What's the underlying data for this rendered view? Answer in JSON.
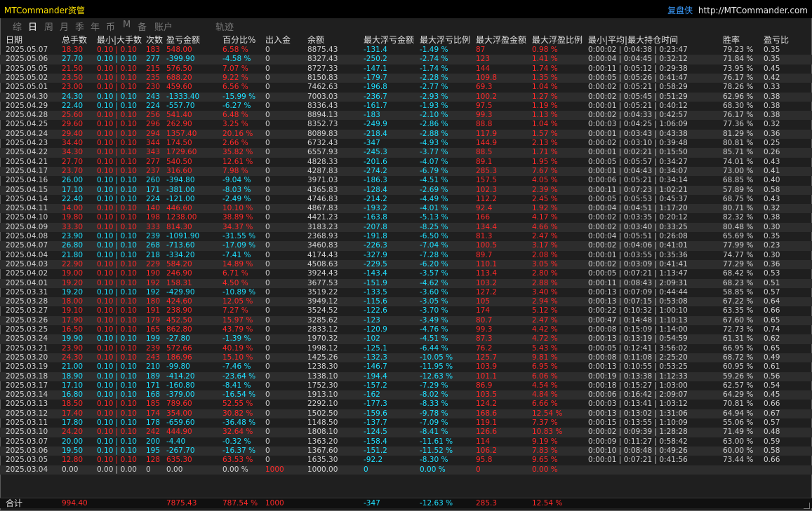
{
  "title": "MTCommander资管",
  "brand": {
    "name": "复盘侠",
    "url": "http://MTCommander.com"
  },
  "tabs": [
    "综",
    "日",
    "周",
    "月",
    "季",
    "年",
    "币",
    "M",
    "备",
    "账户",
    "轨迹"
  ],
  "active_tab": 1,
  "headers": [
    "日期",
    "总手数",
    "最小|大手数",
    "次数",
    "盈亏金额",
    "百分比%",
    "出入金",
    "余额",
    "最大浮亏金额",
    "最大浮亏比例",
    "最大浮盈金额",
    "最大浮盈比例",
    "最小|平均|最大持仓时间",
    "胜率",
    "盈亏比"
  ],
  "rows": [
    [
      "2025.05.07",
      "18.30",
      "0.10 | 0.10",
      "183",
      "548.00",
      "6.58 %",
      "0",
      "8875.43",
      "-131.4",
      "-1.49 %",
      "87",
      "0.98 %",
      "0:00:02 | 0:04:38 | 0:23:47",
      "79.23 %",
      "0.35"
    ],
    [
      "2025.05.06",
      "27.70",
      "0.10 | 0.10",
      "277",
      "-399.90",
      "-4.58 %",
      "0",
      "8327.43",
      "-250.2",
      "-2.74 %",
      "123",
      "1.41 %",
      "0:00:04 | 0:04:45 | 0:32:12",
      "71.84 %",
      "0.35"
    ],
    [
      "2025.05.05",
      "21.50",
      "0.10 | 0.10",
      "215",
      "576.50",
      "7.07 %",
      "0",
      "8727.33",
      "-147.1",
      "-1.74 %",
      "144",
      "1.74 %",
      "0:00:11 | 0:05:12 | 0:29:38",
      "73.95 %",
      "0.45"
    ],
    [
      "2025.05.02",
      "23.50",
      "0.10 | 0.10",
      "235",
      "688.20",
      "9.22 %",
      "0",
      "8150.83",
      "-179.7",
      "-2.28 %",
      "109.8",
      "1.35 %",
      "0:00:05 | 0:05:26 | 0:41:47",
      "76.17 %",
      "0.42"
    ],
    [
      "2025.05.01",
      "23.00",
      "0.10 | 0.10",
      "230",
      "459.60",
      "6.56 %",
      "0",
      "7462.63",
      "-196.8",
      "-2.77 %",
      "69.3",
      "1.04 %",
      "0:00:02 | 0:05:21 | 0:58:29",
      "78.26 %",
      "0.33"
    ],
    [
      "2025.04.30",
      "24.30",
      "0.10 | 0.10",
      "243",
      "-1333.40",
      "-15.99 %",
      "0",
      "7003.03",
      "-236.7",
      "-2.93 %",
      "100.2",
      "1.27 %",
      "0:00:02 | 0:05:45 | 0:51:29",
      "62.96 %",
      "0.38"
    ],
    [
      "2025.04.29",
      "22.40",
      "0.10 | 0.10",
      "224",
      "-557.70",
      "-6.27 %",
      "0",
      "8336.43",
      "-161.7",
      "-1.93 %",
      "97.5",
      "1.19 %",
      "0:00:01 | 0:05:21 | 0:40:12",
      "68.30 %",
      "0.38"
    ],
    [
      "2025.04.28",
      "25.60",
      "0.10 | 0.10",
      "256",
      "541.40",
      "6.48 %",
      "0",
      "8894.13",
      "-183",
      "-2.10 %",
      "99.3",
      "1.13 %",
      "0:00:02 | 0:04:33 | 0:42:57",
      "76.17 %",
      "0.38"
    ],
    [
      "2025.04.25",
      "29.60",
      "0.10 | 0.10",
      "296",
      "262.90",
      "3.25 %",
      "0",
      "8352.73",
      "-249.9",
      "-2.86 %",
      "88.8",
      "1.04 %",
      "0:00:03 | 0:04:25 | 1:06:09",
      "77.36 %",
      "0.32"
    ],
    [
      "2025.04.24",
      "29.40",
      "0.10 | 0.10",
      "294",
      "1357.40",
      "20.16 %",
      "0",
      "8089.83",
      "-218.4",
      "-2.88 %",
      "117.9",
      "1.57 %",
      "0:00:01 | 0:03:43 | 0:43:38",
      "81.29 %",
      "0.36"
    ],
    [
      "2025.04.23",
      "34.40",
      "0.10 | 0.10",
      "344",
      "174.50",
      "2.66 %",
      "0",
      "6732.43",
      "-347",
      "-4.93 %",
      "144.9",
      "2.13 %",
      "0:00:02 | 0:03:10 | 0:39:48",
      "80.81 %",
      "0.25"
    ],
    [
      "2025.04.22",
      "34.30",
      "0.10 | 0.10",
      "343",
      "1729.60",
      "35.82 %",
      "0",
      "6557.93",
      "-245.3",
      "-3.77 %",
      "88.5",
      "1.71 %",
      "0:00:01 | 0:02:21 | 0:15:50",
      "85.71 %",
      "0.26"
    ],
    [
      "2025.04.21",
      "27.70",
      "0.10 | 0.10",
      "277",
      "540.50",
      "12.61 %",
      "0",
      "4828.33",
      "-201.6",
      "-4.07 %",
      "89.1",
      "1.95 %",
      "0:00:05 | 0:05:57 | 0:34:27",
      "74.01 %",
      "0.43"
    ],
    [
      "2025.04.17",
      "23.70",
      "0.10 | 0.10",
      "237",
      "316.60",
      "7.98 %",
      "0",
      "4287.83",
      "-274.2",
      "-6.79 %",
      "285.3",
      "7.67 %",
      "0:00:01 | 0:04:43 | 0:34:07",
      "73.00 %",
      "0.41"
    ],
    [
      "2025.04.16",
      "26.00",
      "0.10 | 0.10",
      "260",
      "-394.80",
      "-9.04 %",
      "0",
      "3971.03",
      "-186.3",
      "-4.51 %",
      "157.5",
      "4.05 %",
      "0:00:06 | 0:05:21 | 0:34:14",
      "68.85 %",
      "0.40"
    ],
    [
      "2025.04.15",
      "17.10",
      "0.10 | 0.10",
      "171",
      "-381.00",
      "-8.03 %",
      "0",
      "4365.83",
      "-128.4",
      "-2.69 %",
      "102.3",
      "2.39 %",
      "0:00:11 | 0:07:23 | 1:02:21",
      "57.89 %",
      "0.58"
    ],
    [
      "2025.04.14",
      "22.40",
      "0.10 | 0.10",
      "224",
      "-121.00",
      "-2.49 %",
      "0",
      "4746.83",
      "-214.2",
      "-4.49 %",
      "112.2",
      "2.45 %",
      "0:00:05 | 0:05:53 | 0:45:37",
      "68.75 %",
      "0.43"
    ],
    [
      "2025.04.11",
      "14.00",
      "0.10 | 0.10",
      "140",
      "446.60",
      "10.10 %",
      "0",
      "4867.83",
      "-193.2",
      "-4.01 %",
      "92.4",
      "1.92 %",
      "0:00:04 | 0:04:51 | 1:17:20",
      "80.71 %",
      "0.32"
    ],
    [
      "2025.04.10",
      "19.80",
      "0.10 | 0.10",
      "198",
      "1238.00",
      "38.89 %",
      "0",
      "4421.23",
      "-163.8",
      "-5.13 %",
      "166",
      "4.17 %",
      "0:00:02 | 0:03:35 | 0:20:12",
      "82.32 %",
      "0.38"
    ],
    [
      "2025.04.09",
      "33.30",
      "0.10 | 0.10",
      "333",
      "814.30",
      "34.37 %",
      "0",
      "3183.23",
      "-207.8",
      "-8.25 %",
      "134.4",
      "4.66 %",
      "0:00:02 | 0:03:40 | 0:33:25",
      "80.48 %",
      "0.30"
    ],
    [
      "2025.04.08",
      "23.90",
      "0.10 | 0.10",
      "239",
      "-1091.90",
      "-31.55 %",
      "0",
      "2368.93",
      "-191.8",
      "-6.50 %",
      "81.3",
      "2.47 %",
      "0:00:04 | 0:05:51 | 0:26:08",
      "65.69 %",
      "0.35"
    ],
    [
      "2025.04.07",
      "26.80",
      "0.10 | 0.10",
      "268",
      "-713.60",
      "-17.09 %",
      "0",
      "3460.83",
      "-226.3",
      "-7.04 %",
      "100.5",
      "3.17 %",
      "0:00:02 | 0:04:06 | 0:41:01",
      "77.99 %",
      "0.23"
    ],
    [
      "2025.04.04",
      "21.80",
      "0.10 | 0.10",
      "218",
      "-334.20",
      "-7.41 %",
      "0",
      "4174.43",
      "-327.9",
      "-7.28 %",
      "89.7",
      "2.08 %",
      "0:00:01 | 0:03:55 | 0:35:36",
      "74.77 %",
      "0.30"
    ],
    [
      "2025.04.03",
      "22.90",
      "0.10 | 0.10",
      "229",
      "584.20",
      "14.89 %",
      "0",
      "4508.63",
      "-229.5",
      "-6.20 %",
      "110.1",
      "3.05 %",
      "0:00:02 | 0:03:09 | 0:41:41",
      "77.29 %",
      "0.36"
    ],
    [
      "2025.04.02",
      "19.00",
      "0.10 | 0.10",
      "190",
      "246.90",
      "6.71 %",
      "0",
      "3924.43",
      "-143.4",
      "-3.57 %",
      "113.4",
      "2.80 %",
      "0:00:05 | 0:07:21 | 1:13:47",
      "68.42 %",
      "0.53"
    ],
    [
      "2025.04.01",
      "19.20",
      "0.10 | 0.10",
      "192",
      "158.31",
      "4.50 %",
      "0",
      "3677.53",
      "-151.9",
      "-4.62 %",
      "103.2",
      "2.88 %",
      "0:00:11 | 0:08:43 | 2:09:31",
      "68.23 %",
      "0.51"
    ],
    [
      "2025.03.31",
      "19.20",
      "0.10 | 0.10",
      "192",
      "-429.90",
      "-10.89 %",
      "0",
      "3519.22",
      "-133.5",
      "-3.60 %",
      "127.2",
      "3.40 %",
      "0:00:13 | 0:07:09 | 0:44:44",
      "58.85 %",
      "0.57"
    ],
    [
      "2025.03.28",
      "18.00",
      "0.10 | 0.10",
      "180",
      "424.60",
      "12.05 %",
      "0",
      "3949.12",
      "-115.6",
      "-3.05 %",
      "105",
      "2.94 %",
      "0:00:13 | 0:07:15 | 0:53:08",
      "67.22 %",
      "0.64"
    ],
    [
      "2025.03.27",
      "19.10",
      "0.10 | 0.10",
      "191",
      "238.90",
      "7.27 %",
      "0",
      "3524.52",
      "-122.6",
      "-3.70 %",
      "174",
      "5.12 %",
      "0:00:22 | 0:10:32 | 1:00:10",
      "63.35 %",
      "0.66"
    ],
    [
      "2025.03.26",
      "17.90",
      "0.10 | 0.10",
      "179",
      "452.50",
      "15.97 %",
      "0",
      "3285.62",
      "-123",
      "-3.49 %",
      "80.7",
      "2.47 %",
      "0:00:47 | 0:14:48 | 1:10:13",
      "67.60 %",
      "0.65"
    ],
    [
      "2025.03.25",
      "16.50",
      "0.10 | 0.10",
      "165",
      "862.80",
      "43.79 %",
      "0",
      "2833.12",
      "-120.9",
      "-4.76 %",
      "99.3",
      "4.42 %",
      "0:00:08 | 0:15:09 | 1:14:00",
      "72.73 %",
      "0.74"
    ],
    [
      "2025.03.24",
      "19.90",
      "0.10 | 0.10",
      "199",
      "-27.80",
      "-1.39 %",
      "0",
      "1970.32",
      "-102",
      "-4.51 %",
      "87.3",
      "4.72 %",
      "0:00:13 | 0:13:19 | 0:54:59",
      "61.31 %",
      "0.62"
    ],
    [
      "2025.03.21",
      "23.90",
      "0.10 | 0.10",
      "239",
      "572.66",
      "40.19 %",
      "0",
      "1998.12",
      "-125.1",
      "-6.44 %",
      "76.2",
      "5.43 %",
      "0:00:05 | 0:12:41 | 3:56:02",
      "66.95 %",
      "0.65"
    ],
    [
      "2025.03.20",
      "24.30",
      "0.10 | 0.10",
      "243",
      "186.96",
      "15.10 %",
      "0",
      "1425.26",
      "-132.3",
      "-10.05 %",
      "125.7",
      "9.81 %",
      "0:00:08 | 0:11:08 | 2:25:20",
      "68.72 %",
      "0.49"
    ],
    [
      "2025.03.19",
      "21.00",
      "0.10 | 0.10",
      "210",
      "-99.80",
      "-7.46 %",
      "0",
      "1238.30",
      "-146.7",
      "-11.95 %",
      "103.9",
      "6.95 %",
      "0:00:13 | 0:10:55 | 0:53:25",
      "60.95 %",
      "0.61"
    ],
    [
      "2025.03.18",
      "18.90",
      "0.10 | 0.10",
      "189",
      "-414.20",
      "-23.64 %",
      "0",
      "1338.10",
      "-194.4",
      "-12.63 %",
      "101.1",
      "6.06 %",
      "0:00:19 | 0:13:38 | 1:12:33",
      "59.26 %",
      "0.56"
    ],
    [
      "2025.03.17",
      "17.10",
      "0.10 | 0.10",
      "171",
      "-160.80",
      "-8.41 %",
      "0",
      "1752.30",
      "-157.2",
      "-7.29 %",
      "86.9",
      "4.54 %",
      "0:00:18 | 0:15:27 | 1:03:00",
      "62.57 %",
      "0.54"
    ],
    [
      "2025.03.14",
      "16.80",
      "0.10 | 0.10",
      "168",
      "-379.00",
      "-16.54 %",
      "0",
      "1913.10",
      "-162",
      "-8.02 %",
      "103.5",
      "4.84 %",
      "0:00:06 | 0:16:42 | 2:09:07",
      "64.29 %",
      "0.45"
    ],
    [
      "2025.03.13",
      "18.50",
      "0.10 | 0.10",
      "185",
      "789.60",
      "52.55 %",
      "0",
      "2292.10",
      "-177.3",
      "-8.33 %",
      "124.2",
      "6.66 %",
      "0:00:03 | 0:13:41 | 1:03:12",
      "70.81 %",
      "0.66"
    ],
    [
      "2025.03.12",
      "17.40",
      "0.10 | 0.10",
      "174",
      "354.00",
      "30.82 %",
      "0",
      "1502.50",
      "-159.6",
      "-9.78 %",
      "168.6",
      "12.54 %",
      "0:00:13 | 0:13:02 | 1:31:06",
      "64.94 %",
      "0.67"
    ],
    [
      "2025.03.11",
      "17.80",
      "0.10 | 0.10",
      "178",
      "-659.60",
      "-36.48 %",
      "0",
      "1148.50",
      "-137.7",
      "-7.09 %",
      "119.1",
      "7.37 %",
      "0:00:15 | 0:13:55 | 1:10:09",
      "55.06 %",
      "0.57"
    ],
    [
      "2025.03.10",
      "24.20",
      "0.10 | 0.10",
      "242",
      "444.90",
      "32.64 %",
      "0",
      "1808.10",
      "-124.5",
      "-8.41 %",
      "126.6",
      "10.83 %",
      "0:00:02 | 0:09:39 | 1:28:28",
      "71.49 %",
      "0.48"
    ],
    [
      "2025.03.07",
      "20.00",
      "0.10 | 0.10",
      "200",
      "-4.40",
      "-0.32 %",
      "0",
      "1363.20",
      "-158.4",
      "-11.61 %",
      "114",
      "9.19 %",
      "0:00:09 | 0:11:27 | 0:58:42",
      "63.00 %",
      "0.59"
    ],
    [
      "2025.03.06",
      "19.50",
      "0.10 | 0.10",
      "195",
      "-267.70",
      "-16.37 %",
      "0",
      "1367.60",
      "-151.2",
      "-11.52 %",
      "106.2",
      "7.83 %",
      "0:00:10 | 0:08:48 | 0:49:26",
      "60.00 %",
      "0.58"
    ],
    [
      "2025.03.05",
      "12.80",
      "0.10 | 0.10",
      "128",
      "635.30",
      "63.53 %",
      "0",
      "1635.30",
      "-92.2",
      "-8.30 %",
      "95.8",
      "9.65 %",
      "0:00:01 | 0:07:21 | 0:41:56",
      "73.44 %",
      "0.66"
    ],
    [
      "2025.03.04",
      "0.00",
      "0.00 | 0.00",
      "0",
      "0.00",
      "0.00 %",
      "1000",
      "1000.00",
      "0",
      "0.00 %",
      "0",
      "0.00 %",
      "",
      "",
      ""
    ]
  ],
  "totals": {
    "label": "合计",
    "lots": "994.40",
    "pnl": "7875.43",
    "pct": "787.54 %",
    "inout": "1000",
    "max_float_loss": "-347",
    "max_float_loss_pct": "-12.63 %",
    "max_float_win": "285.3",
    "max_float_win_pct": "12.54 %"
  },
  "colors": {
    "profit": "#ff2a2a",
    "loss": "#20e0ff",
    "title": "#ffe400",
    "brand": "#3b9dff",
    "background": "#1f1f1f"
  }
}
